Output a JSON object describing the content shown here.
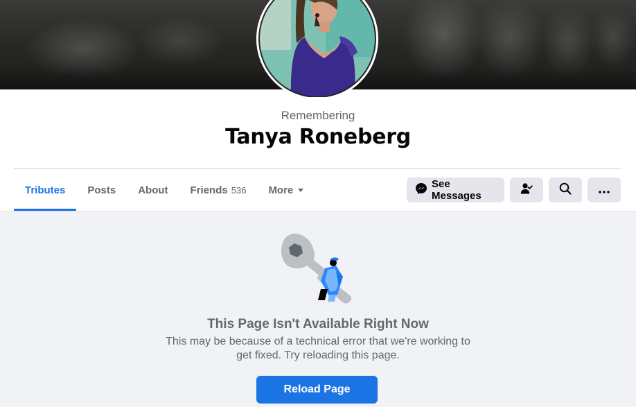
{
  "profile": {
    "remembering_label": "Remembering",
    "name": "Tanya Roneberg"
  },
  "tabs": [
    {
      "label": "Tributes",
      "active": true
    },
    {
      "label": "Posts"
    },
    {
      "label": "About"
    },
    {
      "label": "Friends",
      "count": "536"
    },
    {
      "label": "More"
    }
  ],
  "actions": {
    "see_messages": "See Messages",
    "icons": [
      "messenger-icon",
      "person-check-icon",
      "search-icon",
      "more-icon"
    ]
  },
  "error": {
    "title": "This Page Isn't Available Right Now",
    "body": "This may be because of a technical error that we're working to get fixed. Try reloading this page.",
    "reload_label": "Reload Page"
  },
  "colors": {
    "accent": "#1b74e4",
    "secondary_text": "#65676b",
    "button_bg": "#e4e6eb",
    "page_bg": "#f0f2f5"
  }
}
